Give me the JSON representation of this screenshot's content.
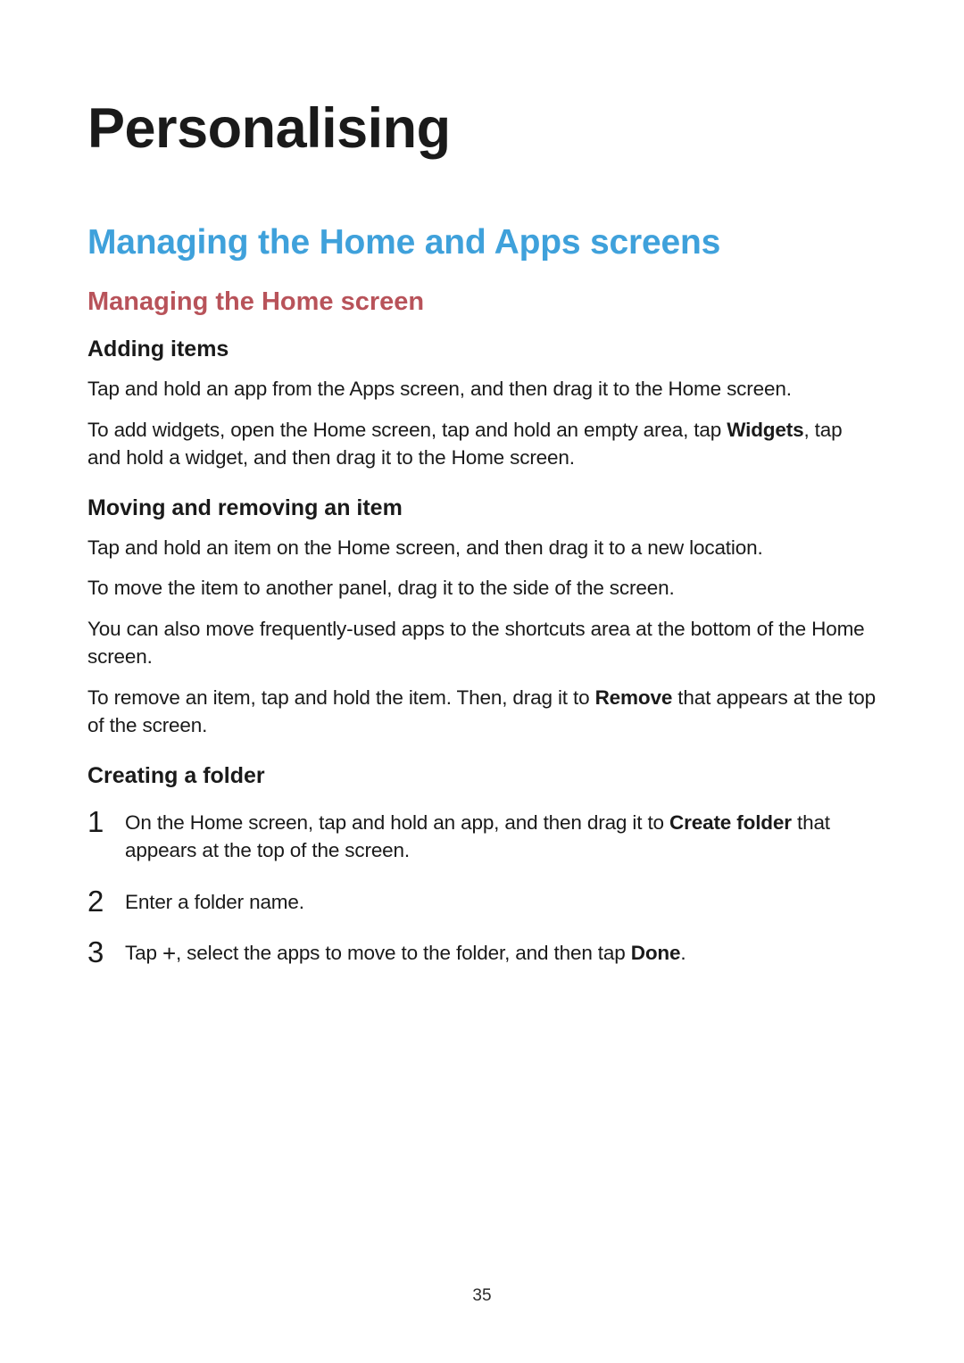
{
  "title": "Personalising",
  "section": "Managing the Home and Apps screens",
  "subsection": "Managing the Home screen",
  "topics": {
    "adding": {
      "heading": "Adding items",
      "p1": "Tap and hold an app from the Apps screen, and then drag it to the Home screen.",
      "p2a": "To add widgets, open the Home screen, tap and hold an empty area, tap ",
      "p2_bold": "Widgets",
      "p2b": ", tap and hold a widget, and then drag it to the Home screen."
    },
    "moving": {
      "heading": "Moving and removing an item",
      "p1": "Tap and hold an item on the Home screen, and then drag it to a new location.",
      "p2": "To move the item to another panel, drag it to the side of the screen.",
      "p3": "You can also move frequently-used apps to the shortcuts area at the bottom of the Home screen.",
      "p4a": "To remove an item, tap and hold the item. Then, drag it to ",
      "p4_bold": "Remove",
      "p4b": " that appears at the top of the screen."
    },
    "folder": {
      "heading": "Creating a folder",
      "step1a": "On the Home screen, tap and hold an app, and then drag it to ",
      "step1_bold": "Create folder",
      "step1b": " that appears at the top of the screen.",
      "step2": "Enter a folder name.",
      "step3a": "Tap ",
      "step3_icon": "+",
      "step3b": ", select the apps to move to the folder, and then tap ",
      "step3_bold": "Done",
      "step3c": "."
    }
  },
  "page_number": "35"
}
